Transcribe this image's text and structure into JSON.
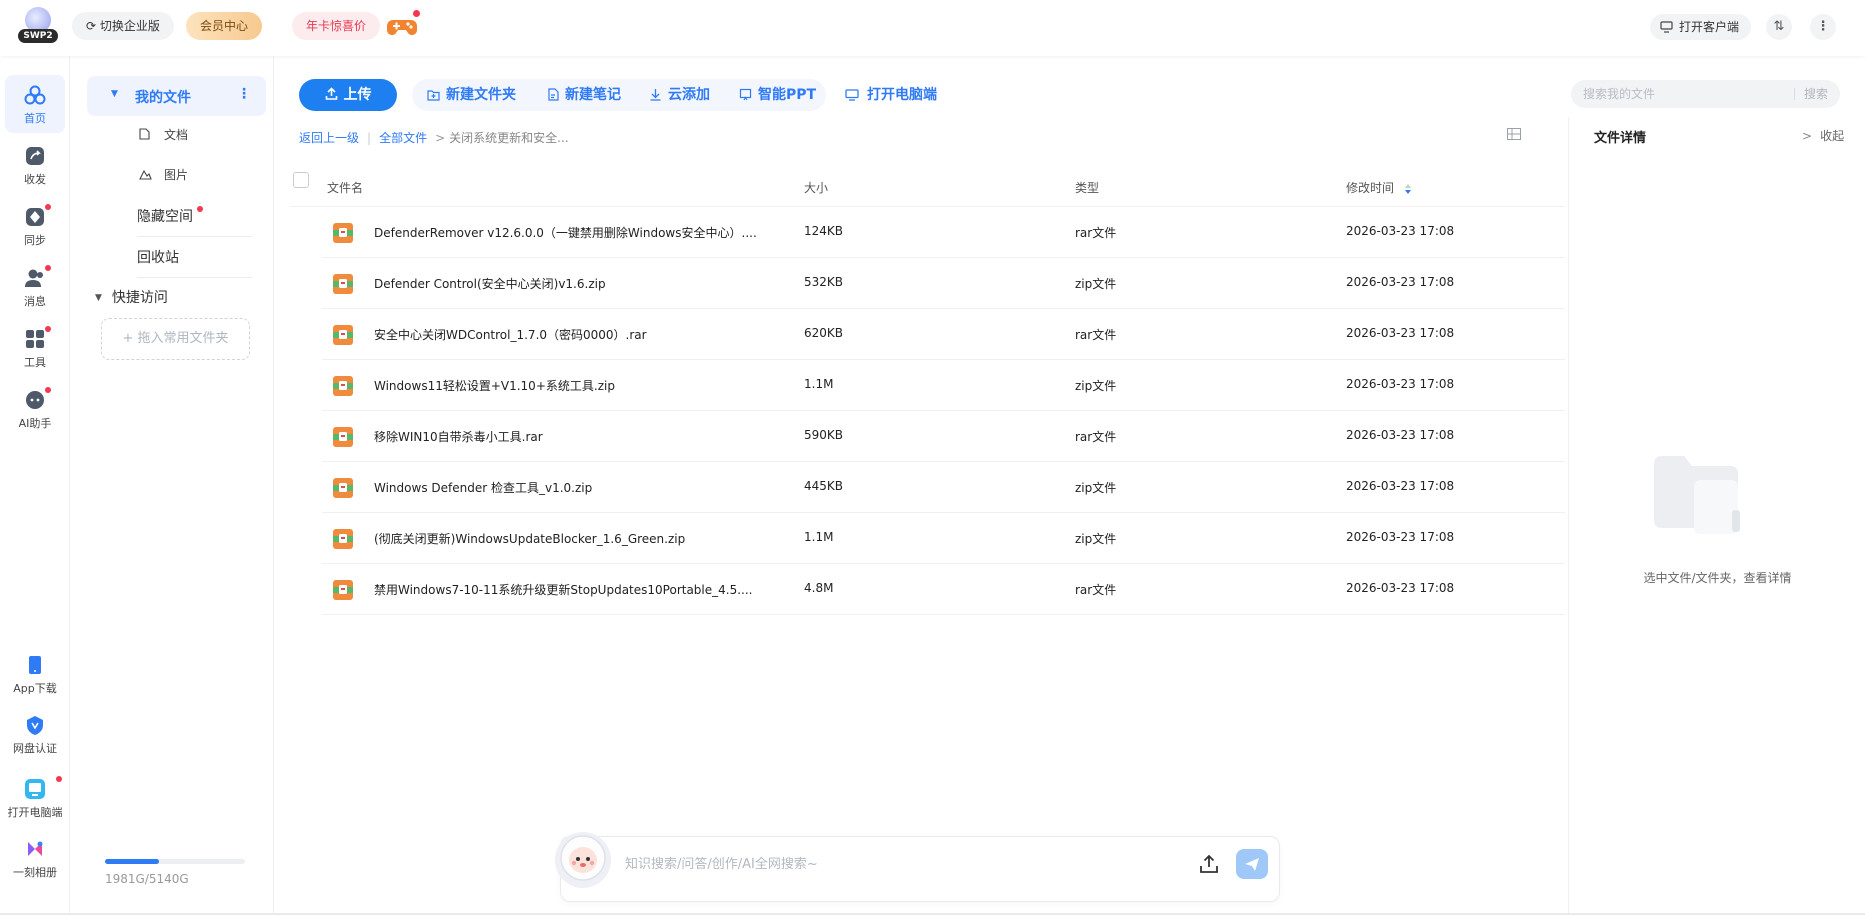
{
  "topbar": {
    "logo_text": "SWP2",
    "enterprise_label": "切换企业版",
    "member_label": "会员中心",
    "annual_label": "年卡惊喜价",
    "open_client_label": "打开客户端"
  },
  "leftnav": {
    "items": [
      {
        "label": "首页"
      },
      {
        "label": "收发"
      },
      {
        "label": "同步"
      },
      {
        "label": "消息"
      },
      {
        "label": "工具"
      },
      {
        "label": "AI助手"
      }
    ],
    "bottom_items": [
      {
        "label": "App下载"
      },
      {
        "label": "网盘认证"
      },
      {
        "label": "打开电脑端"
      },
      {
        "label": "一刻相册"
      }
    ]
  },
  "sidebar": {
    "my_files": "我的文件",
    "docs": "文档",
    "images": "图片",
    "hidden_space": "隐藏空间",
    "recycle": "回收站",
    "quick_access": "快捷访问",
    "drop_hint": "+ 拖入常用文件夹",
    "storage_text": "1981G/5140G",
    "storage_used_fraction": 0.386
  },
  "toolbar": {
    "upload": "上传",
    "new_folder": "新建文件夹",
    "new_note": "新建笔记",
    "cloud_add": "云添加",
    "smart_ppt": "智能PPT",
    "open_desktop": "打开电脑端",
    "search_placeholder": "搜索我的文件",
    "search_button": "搜索"
  },
  "breadcrumb": {
    "back": "返回上一级",
    "all_files": "全部文件",
    "current": "关闭系统更新和安全..."
  },
  "table": {
    "headers": {
      "name": "文件名",
      "size": "大小",
      "type": "类型",
      "modified": "修改时间"
    },
    "rows": [
      {
        "name": "DefenderRemover v12.6.0.0（一键禁用删除Windows安全中心）....",
        "size": "124KB",
        "type": "rar文件",
        "modified": "2026-03-23 17:08"
      },
      {
        "name": "Defender Control(安全中心关闭)v1.6.zip",
        "size": "532KB",
        "type": "zip文件",
        "modified": "2026-03-23 17:08"
      },
      {
        "name": "安全中心关闭WDControl_1.7.0（密码0000）.rar",
        "size": "620KB",
        "type": "rar文件",
        "modified": "2026-03-23 17:08"
      },
      {
        "name": "Windows11轻松设置+V1.10+系统工具.zip",
        "size": "1.1M",
        "type": "zip文件",
        "modified": "2026-03-23 17:08"
      },
      {
        "name": "移除WIN10自带杀毒小工具.rar",
        "size": "590KB",
        "type": "rar文件",
        "modified": "2026-03-23 17:08"
      },
      {
        "name": "Windows Defender 检查工具_v1.0.zip",
        "size": "445KB",
        "type": "zip文件",
        "modified": "2026-03-23 17:08"
      },
      {
        "name": "(彻底关闭更新)WindowsUpdateBlocker_1.6_Green.zip",
        "size": "1.1M",
        "type": "zip文件",
        "modified": "2026-03-23 17:08"
      },
      {
        "name": "禁用Windows7-10-11系统升级更新StopUpdates10Portable_4.5....",
        "size": "4.8M",
        "type": "rar文件",
        "modified": "2026-03-23 17:08"
      }
    ]
  },
  "details": {
    "title": "文件详情",
    "collapse": "收起",
    "empty_hint": "选中文件/文件夹，查看详情"
  },
  "ai_bar": {
    "placeholder": "知识搜索/问答/创作/AI全网搜索~"
  },
  "colors": {
    "accent": "#2f7bf5",
    "upload_button": "#1e7ff0",
    "badge_red": "#f5384f"
  }
}
